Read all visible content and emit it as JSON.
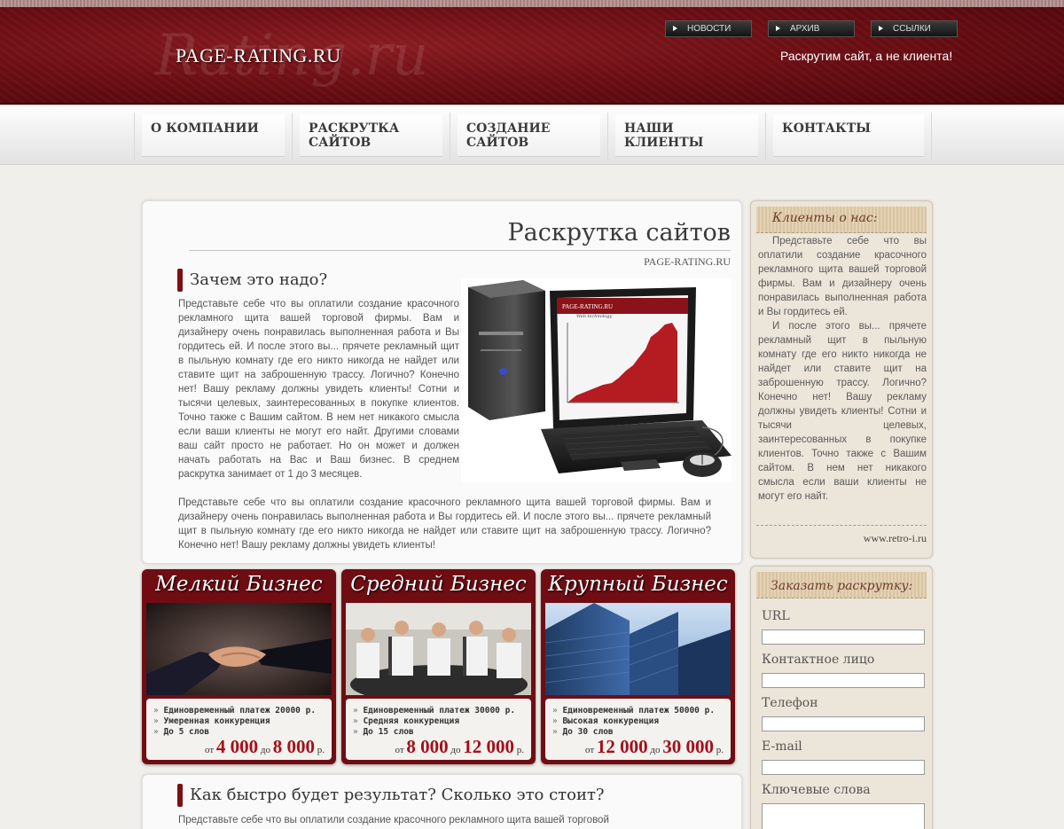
{
  "header": {
    "logo": "PAGE-RATING.RU",
    "logo_watermark": "Rating.ru",
    "nav_buttons": [
      "НОВОСТИ",
      "АРХИВ",
      "ССЫЛКИ"
    ],
    "slogan": "Раскрутим сайт, а не клиента!"
  },
  "nav": {
    "items": [
      "О КОМПАНИИ",
      "РАСКРУТКА\nСАЙТОВ",
      "СОЗДАНИЕ\nСАЙТОВ",
      "НАШИ\nКЛИЕНТЫ",
      "КОНТАКТЫ"
    ]
  },
  "main": {
    "title": "Раскрутка сайтов",
    "subtitle": "PAGE-RATING.RU",
    "section1": {
      "title": "Зачем это надо?",
      "paragraph_short": "Представьте себе что вы оплатили создание красочного рекламного щита вашей торговой фирмы. Вам и дизайнеру очень понравилась выполненная работа и Вы гордитесь ей. И после этого вы... прячете рекламный щит в пыльную комнату где его никто никогда не найдет или ставите щит на заброшенную трассу. Логично? Конечно нет! Вашу рекламу должны увидеть клиенты! Сотни и тысячи целевых, заинтересованных в покупке клиентов. Точно также с Вашим сайтом. В нем нет никакого смысла если ваши клиенты не могут его найт. Другими словами ваш сайт просто не работает. Но он может и должен начать работать на Вас и Ваш бизнес. В среднем раскрутка занимает от 1 до 3 месяцев.",
      "paragraph_wide": "Представьте себе что вы оплатили создание красочного рекламного щита вашей торговой фирмы. Вам и дизайнеру очень понравилась выполненная работа и Вы гордитесь ей. И после этого вы... прячете рекламный щит в пыльную комнату где его никто никогда не найдет или ставите щит на заброшенную трассу. Логично? Конечно нет! Вашу рекламу должны увидеть клиенты!"
    },
    "illustration": {
      "screen_header": "PAGE-RATING.RU",
      "screen_sub": "Web technology"
    },
    "section2": {
      "title": "Как быстро будет результат? Сколько это стоит?",
      "paragraph": "Представьте себе что вы оплатили создание красочного рекламного щита вашей торговой"
    }
  },
  "cards": [
    {
      "title": "Мелкий Бизнес",
      "items": [
        "Единовременный платеж 20000 р.",
        "Умеренная конкуренция",
        "До 5 слов"
      ],
      "price": {
        "from_label": "от",
        "from": "4 000",
        "to_label": "до",
        "to": "8 000",
        "unit": "р."
      }
    },
    {
      "title": "Средний Бизнес",
      "items": [
        "Единовременный платеж 30000 р.",
        "Средняя конкуренция",
        "До 15 слов"
      ],
      "price": {
        "from_label": "от",
        "from": "8 000",
        "to_label": "до",
        "to": "12 000",
        "unit": "р."
      }
    },
    {
      "title": "Крупный Бизнес",
      "items": [
        "Единовременный платеж 50000 р.",
        "Высокая конкуренция",
        "До 30 слов"
      ],
      "price": {
        "from_label": "от",
        "from": "12 000",
        "to_label": "до",
        "to": "30 000",
        "unit": "р."
      }
    }
  ],
  "sidebar": {
    "testimonials": {
      "title": "Клиенты о нас:",
      "p1": "Представьте себе что вы оплатили создание красочного рекламного щита вашей торговой фирмы. Вам и дизайнеру очень понравилась выполненная работа и Вы гордитесь ей.",
      "p2": "И после этого вы... прячете рекламный щит в пыльную комнату где его никто никогда не найдет или ставите щит на заброшенную трассу. Логично? Конечно нет! Вашу рекламу должны увидеть клиенты! Сотни и тысячи целевых, заинтересованных в покупке клиентов. Точно также с Вашим сайтом. В нем нет никакого смысла если ваши клиенты не могут его найт.",
      "footer": "www.retro-i.ru"
    },
    "order_form": {
      "title": "Заказать раскрутку:",
      "fields": [
        {
          "label": "URL",
          "value": ""
        },
        {
          "label": "Контактное лицо",
          "value": ""
        },
        {
          "label": "Телефон",
          "value": ""
        },
        {
          "label": "E-mail",
          "value": ""
        },
        {
          "label": "Ключевые слова",
          "value": ""
        }
      ]
    }
  },
  "colors": {
    "brand_dark_red": "#6f0d13",
    "accent_red": "#a3101b",
    "sidebar_bg": "#ece5d9"
  }
}
